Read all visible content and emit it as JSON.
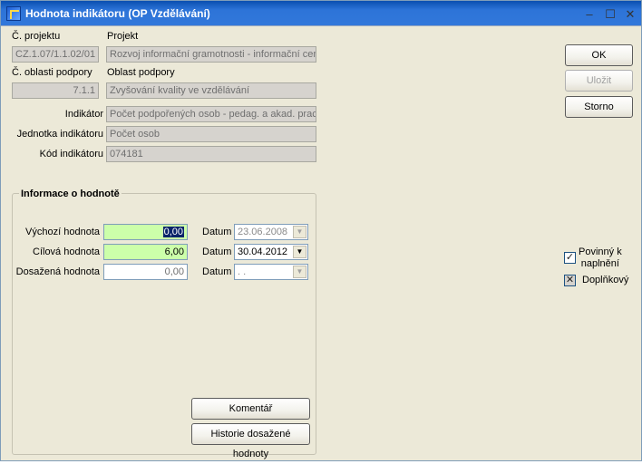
{
  "window": {
    "title": "Hodnota indikátoru   (OP Vzdělávání)",
    "minimize": "–",
    "maximize": "☐",
    "close": "✕"
  },
  "form": {
    "cislo_projektu_label": "Č. projektu",
    "cislo_projektu_value": "CZ.1.07/1.1.02/01",
    "projekt_label": "Projekt",
    "projekt_value": "Rozvoj informační gramotnosti - informační centr",
    "cislo_oblasti_label": "Č. oblasti podpory",
    "cislo_oblasti_value": "7.1.1",
    "oblast_label": "Oblast podpory",
    "oblast_value": "Zvyšování kvality ve vzdělávání",
    "indikator_label": "Indikátor",
    "indikator_value": "Počet podpořených osob - pedag. a akad. prac",
    "jednotka_label": "Jednotka indikátoru",
    "jednotka_value": "Počet osob",
    "kod_label": "Kód indikátoru",
    "kod_value": "074181"
  },
  "group": {
    "title": "Informace o hodnotě",
    "rows": [
      {
        "label": "Výchozí hodnota",
        "value": "0,00",
        "datum_label": "Datum",
        "datum": "23.06.2008"
      },
      {
        "label": "Cílová hodnota",
        "value": "6,00",
        "datum_label": "Datum",
        "datum": "30.04.2012"
      },
      {
        "label": "Dosažená hodnota",
        "value": "0,00",
        "datum_label": "Datum",
        "datum": " .  ."
      }
    ],
    "komentar_button": "Komentář",
    "historie_button": "Historie dosažené hodnoty"
  },
  "buttons": {
    "ok": "OK",
    "ulozit": "Uložit",
    "storno": "Storno"
  },
  "checks": {
    "povinny_line1": "Povinný k",
    "povinny_line2": "naplnění",
    "povinny_mark": "✓",
    "doplnkovy": "Doplňkový",
    "doplnkovy_mark": "✕"
  },
  "colors": {
    "green_field": "#ccffaa",
    "selection": "#0a246a"
  }
}
